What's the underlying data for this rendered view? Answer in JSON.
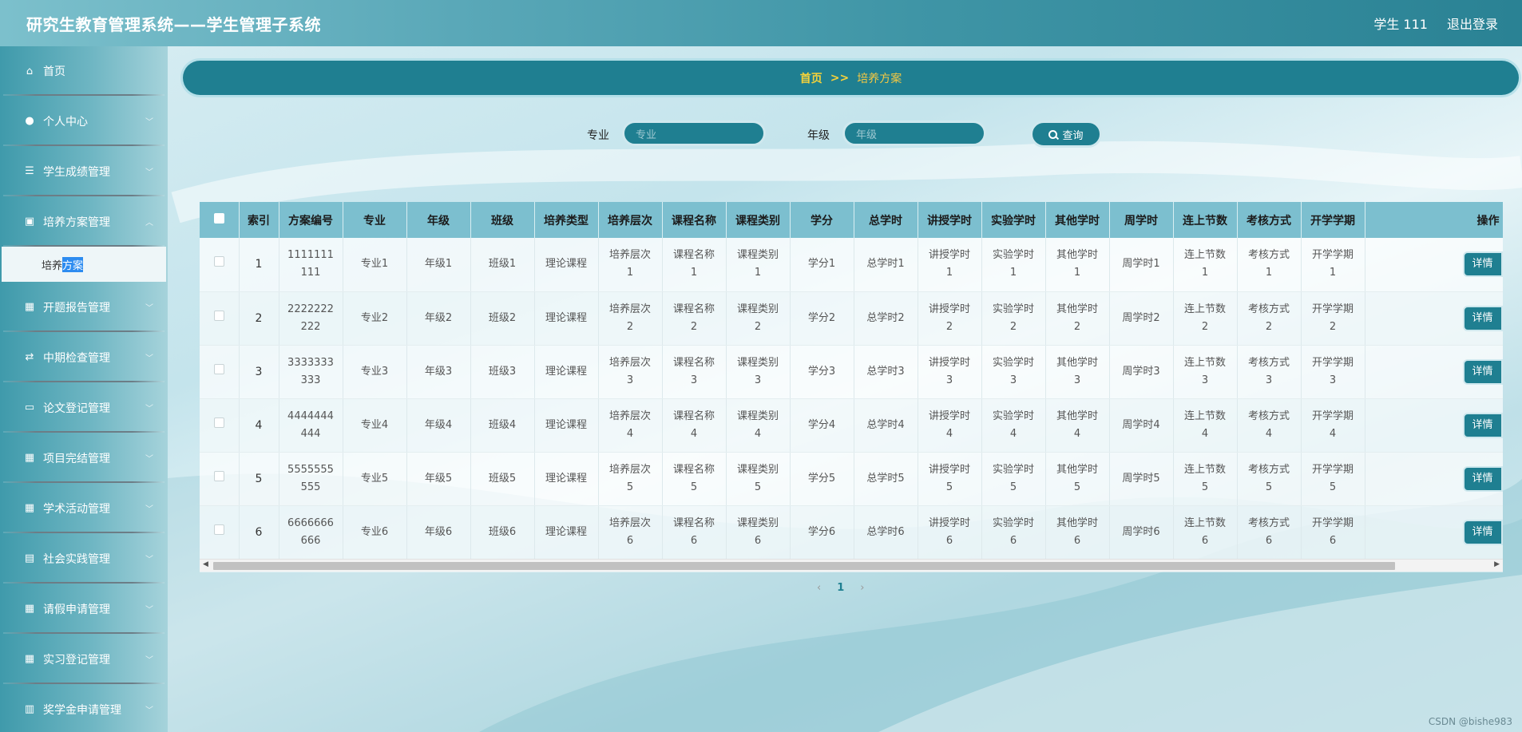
{
  "header": {
    "title": "研究生教育管理系统——学生管理子系统",
    "user": "学生 111",
    "logout": "退出登录"
  },
  "sidebar": {
    "items": [
      {
        "label": "首页",
        "icon": "home-icon",
        "has_children": false
      },
      {
        "label": "个人中心",
        "icon": "user-icon",
        "has_children": true
      },
      {
        "label": "学生成绩管理",
        "icon": "list-icon",
        "has_children": true
      },
      {
        "label": "培养方案管理",
        "icon": "chart-icon",
        "has_children": true,
        "expanded": true
      },
      {
        "label": "开题报告管理",
        "icon": "grid-icon",
        "has_children": true
      },
      {
        "label": "中期检查管理",
        "icon": "transfer-icon",
        "has_children": true
      },
      {
        "label": "论文登记管理",
        "icon": "monitor-icon",
        "has_children": true
      },
      {
        "label": "项目完结管理",
        "icon": "grid-icon",
        "has_children": true
      },
      {
        "label": "学术活动管理",
        "icon": "grid-icon",
        "has_children": true
      },
      {
        "label": "社会实践管理",
        "icon": "clipboard-icon",
        "has_children": true
      },
      {
        "label": "请假申请管理",
        "icon": "grid-icon",
        "has_children": true
      },
      {
        "label": "实习登记管理",
        "icon": "grid-icon",
        "has_children": true
      },
      {
        "label": "奖学金申请管理",
        "icon": "bar-icon",
        "has_children": true
      }
    ],
    "submenu": {
      "label_a": "培养",
      "label_b": "方案"
    }
  },
  "breadcrumb": {
    "home": "首页",
    "separator": ">>",
    "current": "培养方案"
  },
  "search": {
    "major_label": "专业",
    "major_placeholder": "专业",
    "grade_label": "年级",
    "grade_placeholder": "年级",
    "button": "查询"
  },
  "table": {
    "columns": [
      "索引",
      "方案编号",
      "专业",
      "年级",
      "班级",
      "培养类型",
      "培养层次",
      "课程名称",
      "课程类别",
      "学分",
      "总学时",
      "讲授学时",
      "实验学时",
      "其他学时",
      "周学时",
      "连上节数",
      "考核方式",
      "开学学期",
      "操作"
    ],
    "rows": [
      [
        "1",
        "1111111\n111",
        "专业1",
        "年级1",
        "班级1",
        "理论课程",
        "培养层次\n1",
        "课程名称\n1",
        "课程类别\n1",
        "学分1",
        "总学时1",
        "讲授学时\n1",
        "实验学时\n1",
        "其他学时\n1",
        "周学时1",
        "连上节数\n1",
        "考核方式\n1",
        "开学学期\n1"
      ],
      [
        "2",
        "2222222\n222",
        "专业2",
        "年级2",
        "班级2",
        "理论课程",
        "培养层次\n2",
        "课程名称\n2",
        "课程类别\n2",
        "学分2",
        "总学时2",
        "讲授学时\n2",
        "实验学时\n2",
        "其他学时\n2",
        "周学时2",
        "连上节数\n2",
        "考核方式\n2",
        "开学学期\n2"
      ],
      [
        "3",
        "3333333\n333",
        "专业3",
        "年级3",
        "班级3",
        "理论课程",
        "培养层次\n3",
        "课程名称\n3",
        "课程类别\n3",
        "学分3",
        "总学时3",
        "讲授学时\n3",
        "实验学时\n3",
        "其他学时\n3",
        "周学时3",
        "连上节数\n3",
        "考核方式\n3",
        "开学学期\n3"
      ],
      [
        "4",
        "4444444\n444",
        "专业4",
        "年级4",
        "班级4",
        "理论课程",
        "培养层次\n4",
        "课程名称\n4",
        "课程类别\n4",
        "学分4",
        "总学时4",
        "讲授学时\n4",
        "实验学时\n4",
        "其他学时\n4",
        "周学时4",
        "连上节数\n4",
        "考核方式\n4",
        "开学学期\n4"
      ],
      [
        "5",
        "5555555\n555",
        "专业5",
        "年级5",
        "班级5",
        "理论课程",
        "培养层次\n5",
        "课程名称\n5",
        "课程类别\n5",
        "学分5",
        "总学时5",
        "讲授学时\n5",
        "实验学时\n5",
        "其他学时\n5",
        "周学时5",
        "连上节数\n5",
        "考核方式\n5",
        "开学学期\n5"
      ],
      [
        "6",
        "6666666\n666",
        "专业6",
        "年级6",
        "班级6",
        "理论课程",
        "培养层次\n6",
        "课程名称\n6",
        "课程类别\n6",
        "学分6",
        "总学时6",
        "讲授学时\n6",
        "实验学时\n6",
        "其他学时\n6",
        "周学时6",
        "连上节数\n6",
        "考核方式\n6",
        "开学学期\n6"
      ]
    ],
    "detail_button": "详情"
  },
  "pagination": {
    "prev": "‹",
    "current": "1",
    "next": "›"
  },
  "watermark": "CSDN @bishe983",
  "colors": {
    "primary": "#1f7f91",
    "crumb_text": "#f5d23a",
    "header_bg": "#3f95a6"
  }
}
